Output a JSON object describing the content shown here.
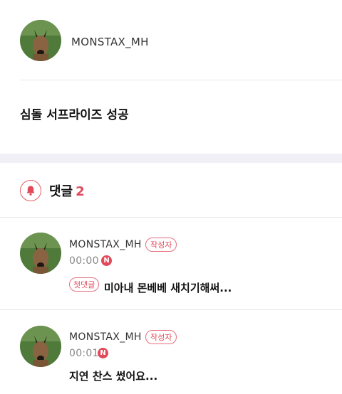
{
  "post": {
    "author": "MONSTAX_MH",
    "title": "심돌 서프라이즈 성공"
  },
  "comments_section": {
    "label": "댓글",
    "count": "2"
  },
  "comments": [
    {
      "author": "MONSTAX_MH",
      "author_tag": "작성자",
      "time": "00:00",
      "new_badge": "N",
      "first_tag": "첫댓글",
      "text": "미아내 몬베베 새치기해써..."
    },
    {
      "author": "MONSTAX_MH",
      "author_tag": "작성자",
      "time": "00:01",
      "new_badge": "N",
      "text": "지연 찬스 썼어요..."
    }
  ],
  "colors": {
    "accent": "#e04a5b",
    "section_bg": "#f0f0f6"
  },
  "icons": [
    "bell-icon",
    "avatar-dog-image"
  ]
}
